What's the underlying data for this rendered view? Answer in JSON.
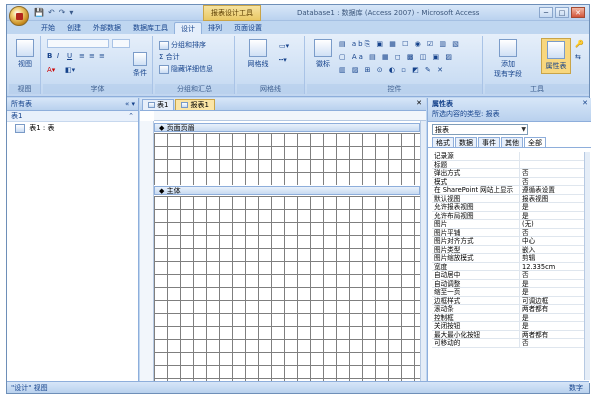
{
  "title": {
    "context_tab": "报表设计工具",
    "window_title": "Database1 : 数据库 (Access 2007) - Microsoft Access",
    "window_buttons": {
      "minimize": "─",
      "maximize": "□",
      "close": "✕"
    },
    "qat": [
      "💾",
      "↶",
      "↷",
      "▾"
    ]
  },
  "ribbon_tabs": [
    "开始",
    "创建",
    "外部数据",
    "数据库工具",
    "设计",
    "排列",
    "页面设置"
  ],
  "active_tab": "设计",
  "ribbon": {
    "view_label": "视图",
    "view_group": "视图",
    "font_group": "字体",
    "condition_label": "条件",
    "grouping": {
      "sort": "分组和排序",
      "total": "合计",
      "hide_details": "隐藏详细信息",
      "group_label": "分组和汇总"
    },
    "gridlines": {
      "label": "网格线",
      "group_label": "网格线"
    },
    "controls": {
      "logo_label": "徽标",
      "group_label": "控件"
    },
    "tools": {
      "add_fields_line1": "添加",
      "add_fields_line2": "现有字段",
      "property_sheet": "属性表",
      "group_label": "工具"
    }
  },
  "nav": {
    "header": "所有表",
    "controls": "« ▾",
    "group": "表1",
    "group_chevron": "⌃",
    "item": "表1 : 表"
  },
  "doc": {
    "tabs": [
      "表1",
      "报表1"
    ],
    "active_tab": "报表1",
    "close": "✕",
    "page_header_section": "◆ 页面页眉",
    "detail_section": "◆ 主体"
  },
  "props": {
    "title": "属性表",
    "close": "✕",
    "selection_label": "所选内容的类型: 报表",
    "selector_value": "报表",
    "tabs": [
      "格式",
      "数据",
      "事件",
      "其他",
      "全部"
    ],
    "active_tab": "全部",
    "rows": [
      {
        "name": "记录源",
        "value": ""
      },
      {
        "name": "标题",
        "value": ""
      },
      {
        "name": "弹出方式",
        "value": "否"
      },
      {
        "name": "模式",
        "value": "否"
      },
      {
        "name": "在 SharePoint 网站上显示",
        "value": "遵循表设置"
      },
      {
        "name": "默认视图",
        "value": "报表视图"
      },
      {
        "name": "允许报表视图",
        "value": "是"
      },
      {
        "name": "允许布局视图",
        "value": "是"
      },
      {
        "name": "图片",
        "value": "(无)"
      },
      {
        "name": "图片平铺",
        "value": "否"
      },
      {
        "name": "图片对齐方式",
        "value": "中心"
      },
      {
        "name": "图片类型",
        "value": "嵌入"
      },
      {
        "name": "图片缩放模式",
        "value": "剪辑"
      },
      {
        "name": "宽度",
        "value": "12.335cm"
      },
      {
        "name": "自动居中",
        "value": "否"
      },
      {
        "name": "自动调整",
        "value": "是"
      },
      {
        "name": "缩至一页",
        "value": "是"
      },
      {
        "name": "边框样式",
        "value": "可调边框"
      },
      {
        "name": "滚动条",
        "value": "两者都有"
      },
      {
        "name": "控制框",
        "value": "是"
      },
      {
        "name": "关闭按钮",
        "value": "是"
      },
      {
        "name": "最大最小化按钮",
        "value": "两者都有"
      },
      {
        "name": "可移动的",
        "value": "否"
      }
    ]
  },
  "status": {
    "left": "\"设计\" 视图",
    "right": "数字"
  }
}
